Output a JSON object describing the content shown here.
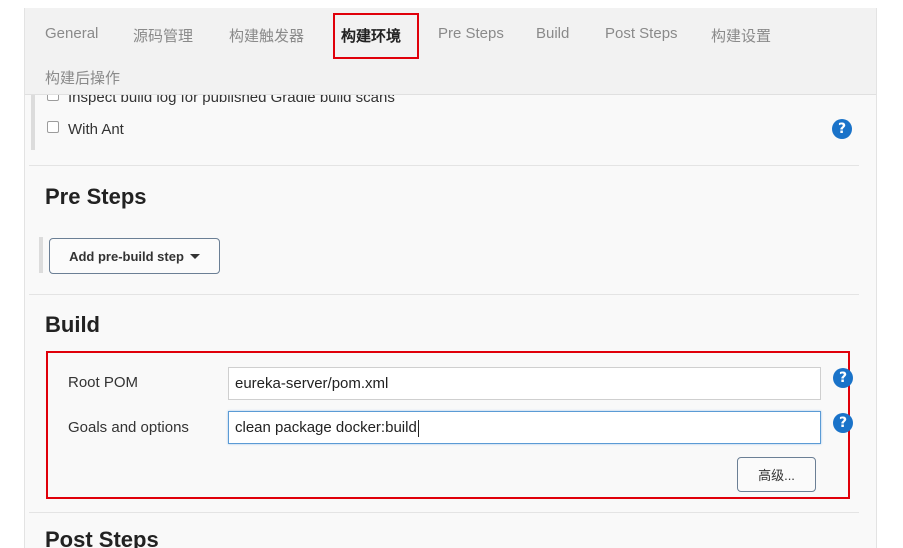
{
  "tabs": [
    {
      "label": "General",
      "active": false
    },
    {
      "label": "源码管理",
      "active": false
    },
    {
      "label": "构建触发器",
      "active": false
    },
    {
      "label": "构建环境",
      "active": true
    },
    {
      "label": "Pre Steps",
      "active": false
    },
    {
      "label": "Build",
      "active": false
    },
    {
      "label": "Post Steps",
      "active": false
    },
    {
      "label": "构建设置",
      "active": false
    },
    {
      "label": "构建后操作",
      "active": false
    }
  ],
  "build_env": {
    "options": [
      {
        "label": "Inspect build log for published Gradle build scans",
        "checked": false
      },
      {
        "label": "With Ant",
        "checked": false
      }
    ]
  },
  "pre_steps": {
    "title": "Pre Steps",
    "add_button_label": "Add pre-build step"
  },
  "build": {
    "title": "Build",
    "root_pom_label": "Root POM",
    "root_pom_value": "eureka-server/pom.xml",
    "goals_label": "Goals and options",
    "goals_value": "clean package docker:build",
    "advanced_label": "高级..."
  },
  "post_steps": {
    "title": "Post Steps"
  },
  "help_icon_glyph": "?",
  "colors": {
    "highlight_border": "#e0000a",
    "help_icon": "#1a73c9",
    "focus_border": "#5b9bd5"
  }
}
